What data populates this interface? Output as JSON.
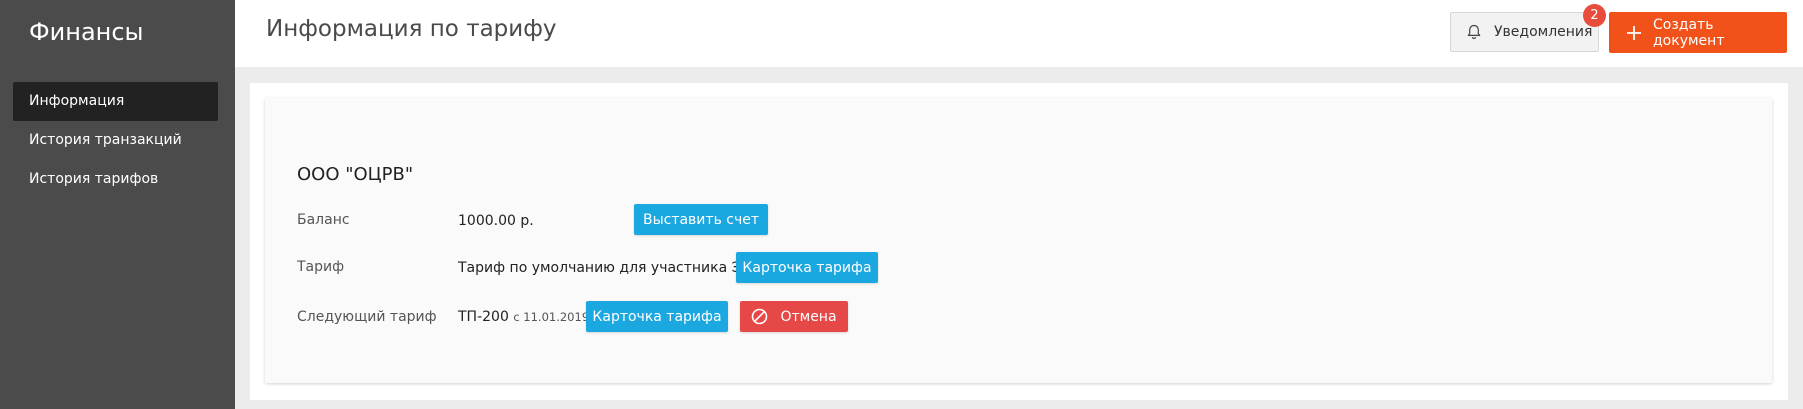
{
  "sidebar": {
    "title": "Финансы",
    "items": [
      {
        "label": "Информация",
        "active": true
      },
      {
        "label": "История транзакций",
        "active": false
      },
      {
        "label": "История тарифов",
        "active": false
      }
    ]
  },
  "header": {
    "title": "Информация по тарифу",
    "notifications": {
      "label": "Уведомления",
      "icon": "bell-icon",
      "count": "2"
    },
    "create_button": {
      "label": "Создать документ",
      "icon": "plus-icon"
    }
  },
  "card": {
    "company": "ООО \"ОЦРВ\"",
    "balance": {
      "label": "Баланс",
      "value": "1000.00 р.",
      "button": "Выставить счет"
    },
    "tariff": {
      "label": "Тариф",
      "value": "Тариф по умолчанию для участника ЭДО",
      "button": "Карточка тарифа"
    },
    "next_tariff": {
      "label": "Следующий тариф",
      "value": "ТП-200",
      "date": "с 11.01.2019",
      "button": "Карточка тарифа",
      "cancel_button": "Отмена",
      "cancel_icon": "cancel-icon"
    }
  },
  "colors": {
    "sidebar_bg": "#4b4b4b",
    "accent_orange": "#f0521a",
    "button_blue": "#1ba8e0",
    "button_red": "#e64848",
    "badge_red": "#e84c3d"
  }
}
